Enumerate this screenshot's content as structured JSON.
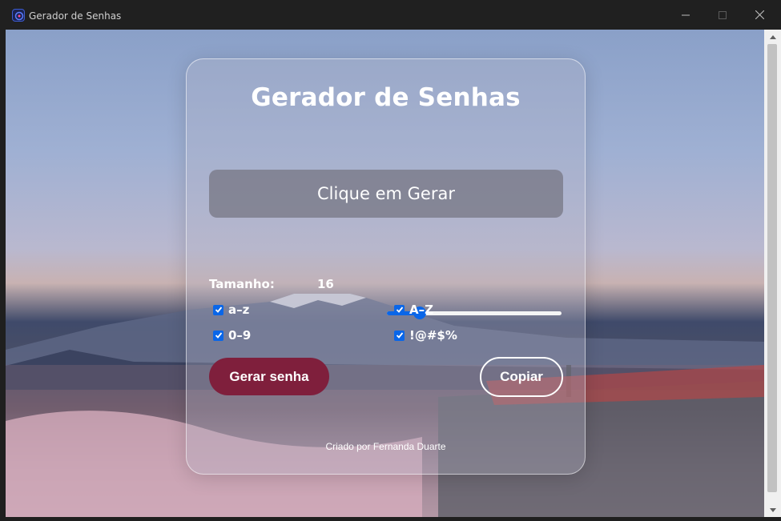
{
  "window": {
    "title": "Gerador de Senhas"
  },
  "card": {
    "title": "Gerador de Senhas",
    "password_display": "Clique em Gerar",
    "length_label": "Tamanho:",
    "length_value": "16",
    "length_slider_fraction": 0.19,
    "options": [
      {
        "label": "a–z",
        "checked": true
      },
      {
        "label": "A–Z",
        "checked": true
      },
      {
        "label": "0–9",
        "checked": true
      },
      {
        "label": "!@#$%",
        "checked": true
      }
    ],
    "generate_label": "Gerar senha",
    "copy_label": "Copiar",
    "footer": "Criado por Fernanda Duarte"
  },
  "colors": {
    "accent": "#0a66e8",
    "generate_button": "#7f1f3c",
    "titlebar": "#202020"
  }
}
